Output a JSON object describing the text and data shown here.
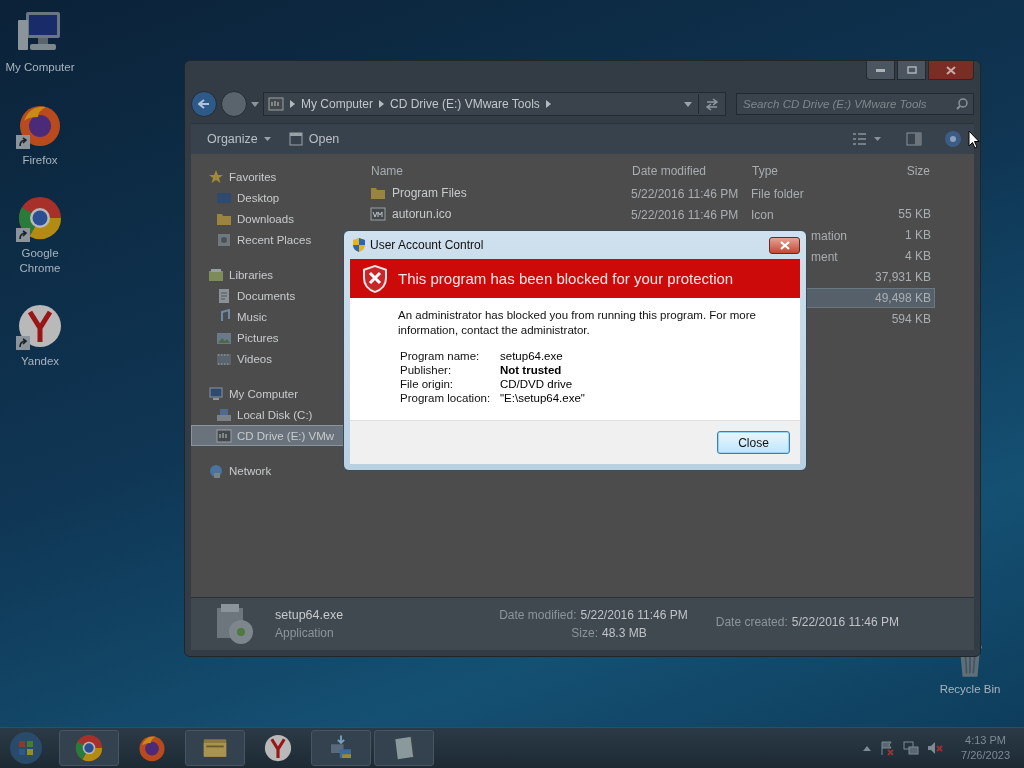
{
  "desktop_icons": [
    {
      "label": "My Computer",
      "kind": "computer",
      "shortcut": false
    },
    {
      "label": "Firefox",
      "kind": "firefox",
      "shortcut": true
    },
    {
      "label": "Google Chrome",
      "kind": "chrome",
      "shortcut": true
    },
    {
      "label": "Yandex",
      "kind": "yandex",
      "shortcut": true
    }
  ],
  "recycle_bin": {
    "label": "Recycle Bin"
  },
  "explorer": {
    "address": [
      "My Computer",
      "CD Drive (E:) VMware Tools"
    ],
    "search": {
      "placeholder": "Search CD Drive (E:) VMware Tools"
    },
    "toolbar": [
      {
        "label": "Organize",
        "kind": "menu"
      },
      {
        "label": "Open",
        "kind": "action"
      }
    ],
    "sidebar": [
      {
        "label": "Favorites",
        "kind": "star",
        "selected": false,
        "children": [
          {
            "label": "Desktop",
            "kind": "desktop",
            "selected": false
          },
          {
            "label": "Downloads",
            "kind": "folder",
            "selected": false
          },
          {
            "label": "Recent Places",
            "kind": "recent",
            "selected": false
          }
        ]
      },
      {
        "label": "Libraries",
        "kind": "library",
        "selected": false,
        "children": [
          {
            "label": "Documents",
            "kind": "document",
            "selected": false
          },
          {
            "label": "Music",
            "kind": "music",
            "selected": false
          },
          {
            "label": "Pictures",
            "kind": "pictures",
            "selected": false
          },
          {
            "label": "Videos",
            "kind": "video",
            "selected": false
          }
        ]
      },
      {
        "label": "My Computer",
        "kind": "computer",
        "selected": false,
        "children": [
          {
            "label": "Local Disk (C:)",
            "kind": "disk",
            "selected": false
          },
          {
            "label": "CD Drive (E:) VMw",
            "kind": "drive",
            "selected": true
          }
        ]
      },
      {
        "label": "Network",
        "kind": "network",
        "selected": false
      }
    ],
    "columns": [
      "Name",
      "Date modified",
      "Type",
      "Size"
    ],
    "rows": [
      {
        "name": "Program Files",
        "kind": "folder",
        "date": "5/22/2016 11:46 PM",
        "type": "File folder",
        "selected": false
      },
      {
        "name": "autorun.ico",
        "kind": "vm",
        "date": "5/22/2016 11:46 PM",
        "type": "Icon",
        "size": "55 KB",
        "selected": false
      },
      {
        "type": "mation",
        "size": "1 KB",
        "selected": false
      },
      {
        "type": "ment",
        "size": "4 KB",
        "selected": false
      },
      {
        "size": "37,931 KB",
        "selected": false
      },
      {
        "size": "49,498 KB",
        "selected": true
      },
      {
        "size": "594 KB",
        "selected": false
      }
    ],
    "details": {
      "name": "setup64.exe",
      "type": "Application",
      "date_modified": {
        "label": "Date modified:",
        "value": "5/22/2016 11:46 PM"
      },
      "size": {
        "label": "Size:",
        "value": "48.3 MB"
      },
      "date_created": {
        "label": "Date created:",
        "value": "5/22/2016 11:46 PM"
      }
    }
  },
  "dialog": {
    "title": "User Account Control",
    "heading": "This program has been blocked for your protection",
    "message": "An administrator has blocked you from running this program. For more information, contact the administrator.",
    "fields": [
      {
        "label": "Program name:",
        "value": "setup64.exe",
        "emphasis": false
      },
      {
        "label": "Publisher:",
        "value": "Not trusted",
        "emphasis": true
      },
      {
        "label": "File origin:",
        "value": "CD/DVD drive",
        "emphasis": false
      },
      {
        "label": "Program location:",
        "value": "\"E:\\setup64.exe\"",
        "emphasis": false
      }
    ],
    "button": "Close"
  },
  "taskbar": {
    "apps": [
      {
        "kind": "chrome",
        "running": true
      },
      {
        "kind": "firefox",
        "running": false
      },
      {
        "kind": "explorer",
        "running": true
      },
      {
        "kind": "yandex",
        "running": false
      },
      {
        "kind": "network",
        "running": true
      },
      {
        "kind": "notepad",
        "running": true
      }
    ],
    "clock": {
      "time": "4:13 PM",
      "date": "7/26/2023"
    }
  }
}
